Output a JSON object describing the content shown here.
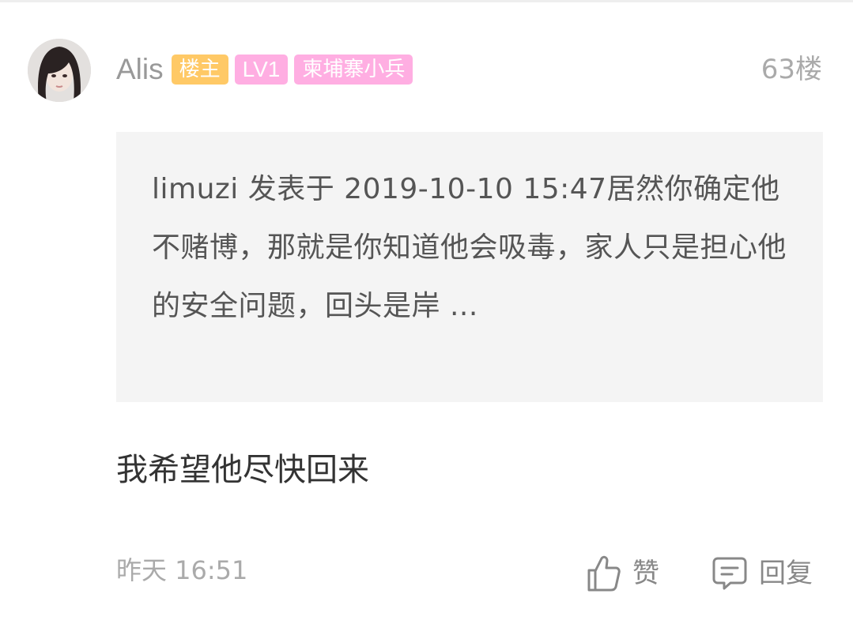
{
  "post": {
    "username": "Alis",
    "badges": {
      "owner": "楼主",
      "level": "LV1",
      "title": "柬埔寨小兵"
    },
    "floor": "63楼",
    "quote": "limuzi 发表于 2019-10-10 15:47居然你确定他不赌博，那就是你知道他会吸毒，家人只是担心他的安全问题，回头是岸 ...",
    "content": "我希望他尽快回来",
    "timestamp": "昨天 16:51",
    "actions": {
      "like_label": "赞",
      "reply_label": "回复"
    }
  },
  "icons": {
    "like": "thumbs-up-icon",
    "reply": "comment-icon"
  },
  "colors": {
    "owner_badge": "#ffc966",
    "pink_badge": "#ffaee2",
    "quote_bg": "#f4f4f4",
    "muted_text": "#aaaaaa"
  }
}
